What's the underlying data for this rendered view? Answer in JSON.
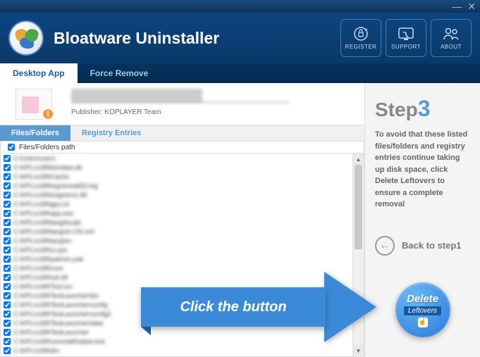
{
  "window": {
    "minimize": "—",
    "close": "✕"
  },
  "header": {
    "title": "Bloatware Uninstaller",
    "buttons": {
      "register": "REGISTER",
      "support": "SUPPORT",
      "about": "ABOUT"
    }
  },
  "main_tabs": {
    "desktop": "Desktop App",
    "force": "Force Remove"
  },
  "app_info": {
    "publisher_label": "Publisher:",
    "publisher_value": "KOPLAYER Team"
  },
  "sub_tabs": {
    "files": "Files/Folders",
    "registry": "Registry Entries"
  },
  "list": {
    "header": "Files/Folders path",
    "items": [
      "C:\\Users\\user1",
      "C:\\KPL\\v189\\bin\\data.db",
      "C:\\KPL\\v189\\Cache",
      "C:\\KPL\\v189\\logs\\install20.log",
      "C:\\KPL\\v189\\engine\\v1.89",
      "C:\\KPL\\v189\\gpu.ini",
      "C:\\KPL\\v189\\app.exe",
      "C:\\KPL\\v189\\lang\\locale",
      "C:\\KPL\\v189\\lang\\zh-CN.xml",
      "C:\\KPL\\v189\\lang\\en",
      "C:\\KPL\\v189\\ui.qss",
      "C:\\KPL\\v189\\pak\\res.pak",
      "C:\\KPL\\v189\\core",
      "C:\\KPL\\v189\\net.dll",
      "C:\\KPL\\v189\\Tool.ico",
      "C:\\KPL\\v189\\TestLauncher\\bin",
      "C:\\KPL\\v189\\TestLauncher\\config",
      "C:\\KPL\\v189\\TestLauncher\\config2",
      "C:\\KPL\\v189\\TestLauncher\\data",
      "C:\\KPL\\v189\\TestLauncher",
      "C:\\KPL\\v189\\uninstall\\helper.exe",
      "C:\\KPL\\v189\\drv"
    ]
  },
  "sidebar": {
    "step_label": "Step",
    "step_num": "3",
    "description": "To avoid that these listed files/folders and registry entries continue taking up disk space, click Delete Leftovers to ensure a complete removal",
    "back": "Back to step1",
    "delete_main": "Delete",
    "delete_sub": "Leftovers"
  },
  "callout": {
    "text": "Click the button"
  }
}
